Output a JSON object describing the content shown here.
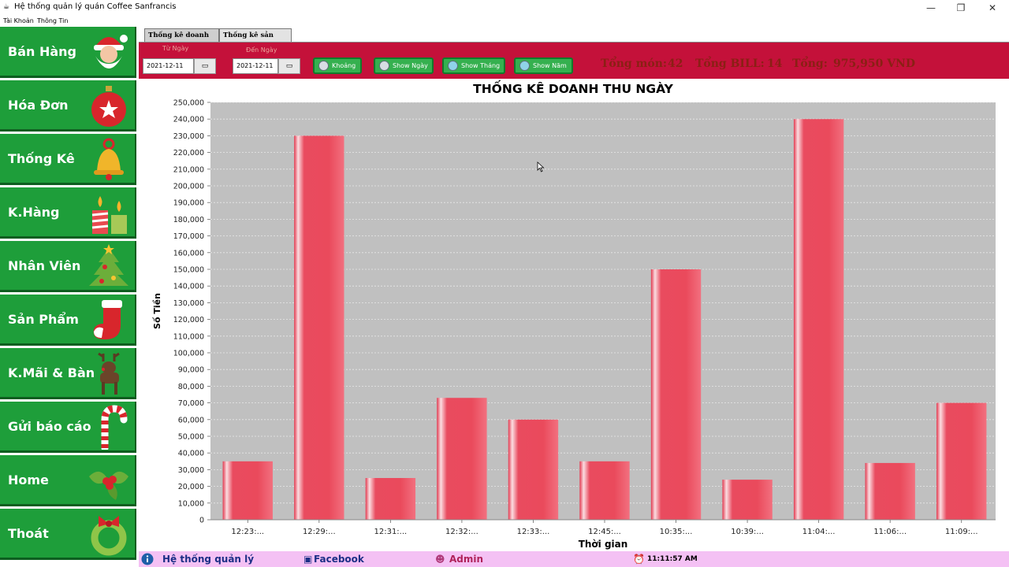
{
  "window": {
    "title": "Hệ thống quản lý quán Coffee Sanfrancis",
    "minimize": "—",
    "maximize": "❐",
    "close": "✕"
  },
  "menu": [
    "Tài Khoản",
    "Thông Tin"
  ],
  "sidebar": [
    {
      "label": "Bán Hàng",
      "icon": "santa-icon"
    },
    {
      "label": "Hóa Đơn",
      "icon": "ornament-icon"
    },
    {
      "label": "Thống Kê",
      "icon": "bell-icon"
    },
    {
      "label": "K.Hàng",
      "icon": "candles-icon"
    },
    {
      "label": "Nhân Viên",
      "icon": "christmas-tree-icon"
    },
    {
      "label": "Sản Phẩm",
      "icon": "stocking-icon"
    },
    {
      "label": "K.Mãi & Bàn",
      "icon": "reindeer-icon"
    },
    {
      "label": "Gửi báo cáo",
      "icon": "candy-cane-icon"
    },
    {
      "label": "Home",
      "icon": "holly-icon"
    },
    {
      "label": "Thoát",
      "icon": "wreath-icon"
    }
  ],
  "tabs": [
    "Thống kê doanh thu",
    "Thống kê sản phẩm"
  ],
  "filter": {
    "from_label": "Từ Ngày",
    "from_value": "2021-12-11",
    "to_label": "Đến Ngày",
    "to_value": "2021-12-11",
    "buttons": [
      "Khoảng",
      "Show Ngày",
      "Show Tháng",
      "Show Năm"
    ]
  },
  "summary": {
    "items_label": "Tổng món:",
    "items_value": "42",
    "bill_label": "Tổng BILL:",
    "bill_value": "14",
    "total_label": "Tổng:",
    "total_value": "975,950 VND"
  },
  "chart_data": {
    "type": "bar",
    "title": "THỐNG KÊ DOANH THU NGÀY",
    "xlabel": "Thời gian",
    "ylabel": "Số Tiền",
    "categories": [
      "12:23:...",
      "12:29:...",
      "12:31:...",
      "12:32:...",
      "12:33:...",
      "12:45:...",
      "10:35:...",
      "10:39:...",
      "11:04:...",
      "11:06:...",
      "11:09:..."
    ],
    "values": [
      35000,
      230000,
      25000,
      73000,
      60000,
      35000,
      150000,
      24000,
      240000,
      34000,
      70000
    ],
    "ylim": [
      0,
      250000
    ],
    "ytick_step": 10000,
    "grid": true,
    "colors": {
      "bar": "#e94b5f",
      "plot_bg": "#c0c0c0",
      "grid": "#e8e8e8"
    }
  },
  "statusbar": {
    "system": "Hệ thống quản lý",
    "facebook": "Facebook",
    "admin": "Admin",
    "clock": "11:11:57 AM"
  },
  "colors": {
    "sidebar_green": "#1e9e3a",
    "toolbar_red": "#c4113a",
    "status_pink": "#f4c1f4"
  }
}
